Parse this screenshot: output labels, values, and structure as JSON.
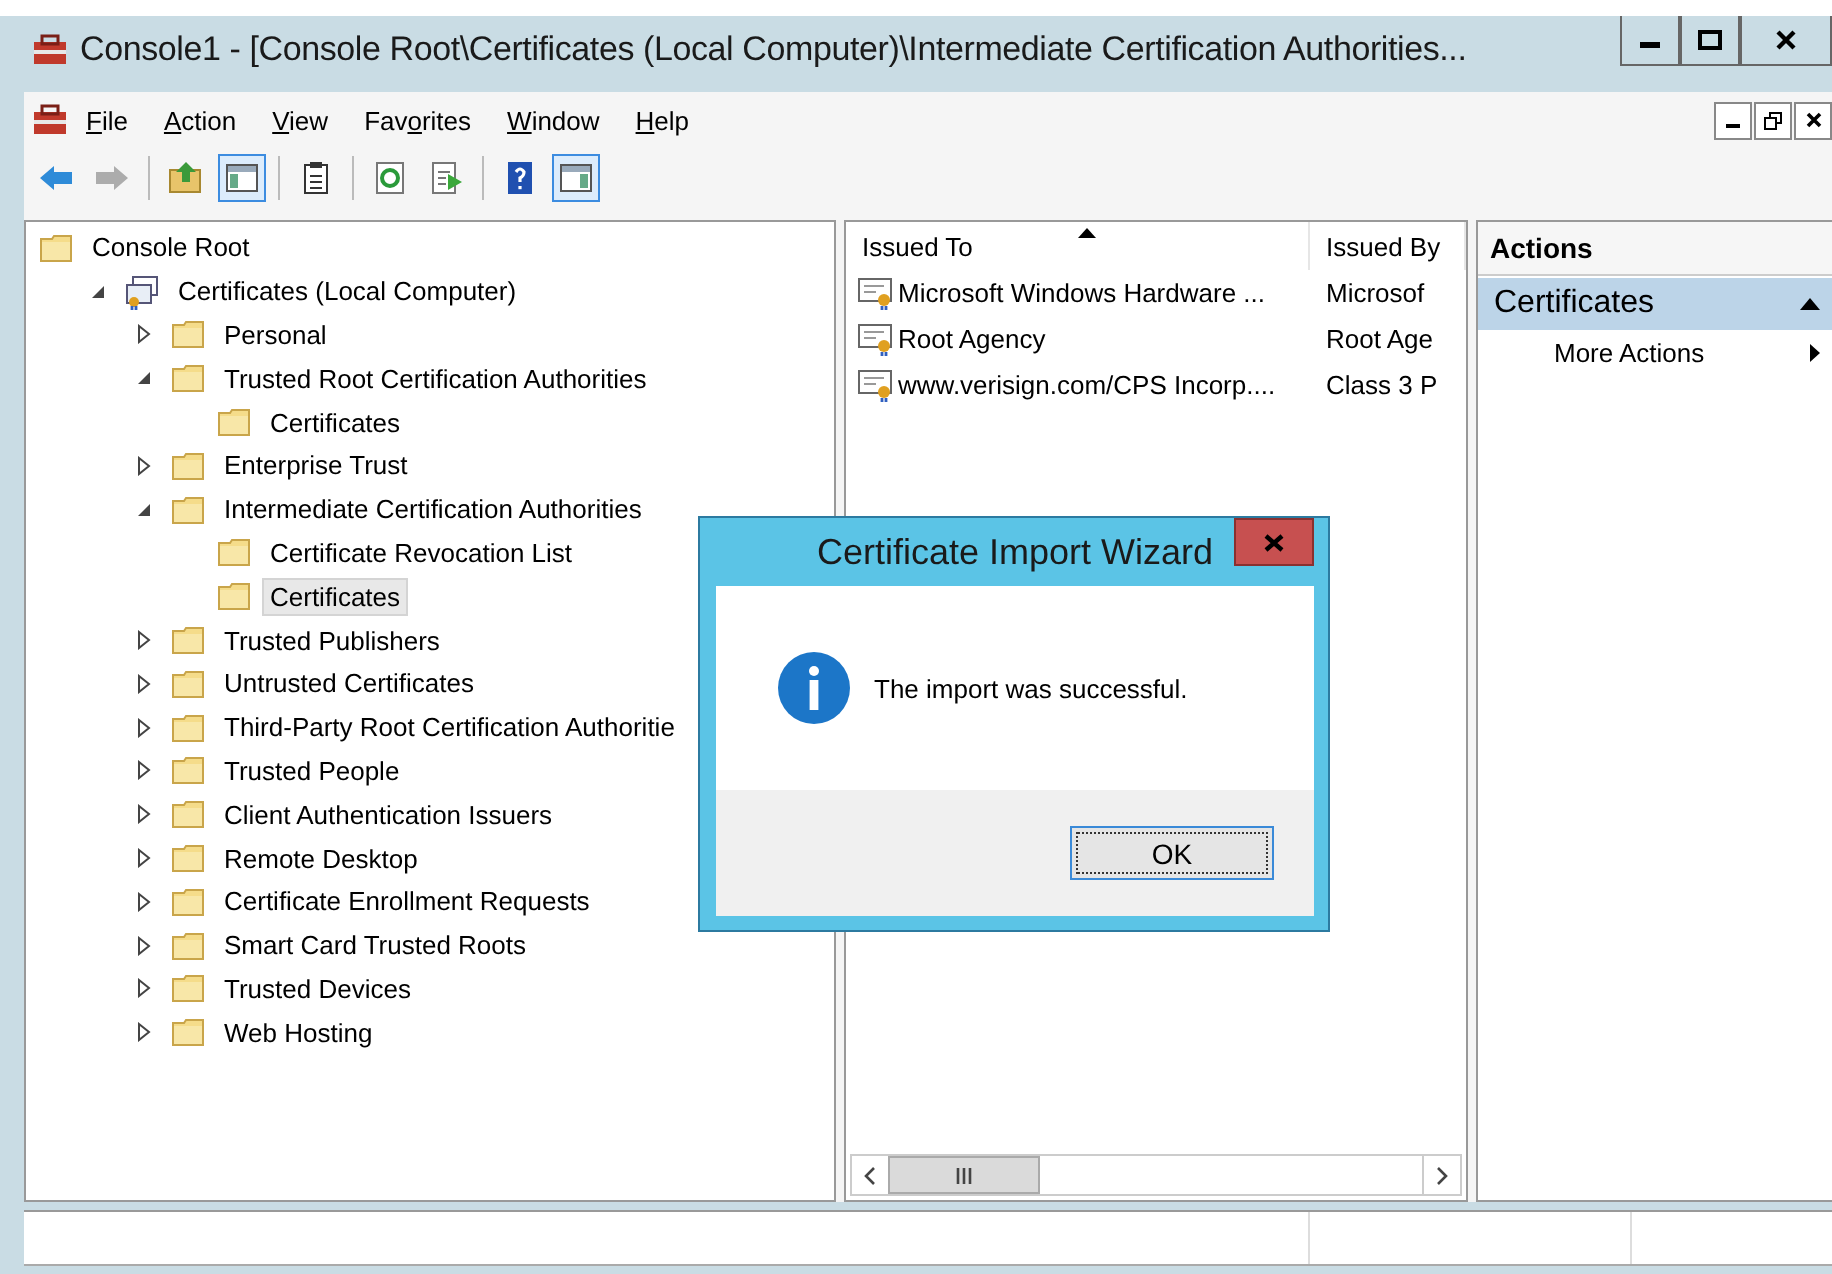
{
  "window": {
    "title": "Console1 - [Console Root\\Certificates (Local Computer)\\Intermediate Certification Authorities..."
  },
  "menu": [
    {
      "key": "F",
      "post": "ile"
    },
    {
      "key": "A",
      "post": "ction"
    },
    {
      "key": "V",
      "post": "iew"
    },
    {
      "pre": "Fav",
      "key": "o",
      "post": "rites"
    },
    {
      "key": "W",
      "post": "indow"
    },
    {
      "key": "H",
      "post": "elp"
    }
  ],
  "toolbar": [
    {
      "kind": "back",
      "pressed": false,
      "disabled": false
    },
    {
      "kind": "forward",
      "pressed": false,
      "disabled": true
    },
    {
      "kind": "sep"
    },
    {
      "kind": "up",
      "pressed": false,
      "disabled": false
    },
    {
      "kind": "tree",
      "pressed": true,
      "disabled": false
    },
    {
      "kind": "sep"
    },
    {
      "kind": "clipboard",
      "pressed": false,
      "disabled": false
    },
    {
      "kind": "sep"
    },
    {
      "kind": "refresh",
      "pressed": false,
      "disabled": false
    },
    {
      "kind": "export",
      "pressed": false,
      "disabled": false
    },
    {
      "kind": "sep"
    },
    {
      "kind": "help",
      "pressed": false,
      "disabled": false
    },
    {
      "kind": "actionpane",
      "pressed": true,
      "disabled": false
    }
  ],
  "tree": [
    {
      "label": "Console Root",
      "kind": "folder",
      "selected": false,
      "children": [
        {
          "label": "Certificates (Local Computer)",
          "kind": "store",
          "selected": false,
          "expanded": true,
          "children": [
            {
              "label": "Personal",
              "kind": "folder",
              "selected": false,
              "expanded": false
            },
            {
              "label": "Trusted Root Certification Authorities",
              "kind": "folder",
              "selected": false,
              "expanded": true,
              "children": [
                {
                  "label": "Certificates",
                  "kind": "folder",
                  "selected": false
                }
              ]
            },
            {
              "label": "Enterprise Trust",
              "kind": "folder",
              "selected": false,
              "expanded": false
            },
            {
              "label": "Intermediate Certification Authorities",
              "kind": "folder",
              "selected": false,
              "expanded": true,
              "children": [
                {
                  "label": "Certificate Revocation List",
                  "kind": "folder",
                  "selected": false
                },
                {
                  "label": "Certificates",
                  "kind": "folder",
                  "selected": true
                }
              ]
            },
            {
              "label": "Trusted Publishers",
              "kind": "folder",
              "selected": false,
              "expanded": false
            },
            {
              "label": "Untrusted Certificates",
              "kind": "folder",
              "selected": false,
              "expanded": false
            },
            {
              "label": "Third-Party Root Certification Authoritie",
              "kind": "folder",
              "selected": false,
              "expanded": false
            },
            {
              "label": "Trusted People",
              "kind": "folder",
              "selected": false,
              "expanded": false
            },
            {
              "label": "Client Authentication Issuers",
              "kind": "folder",
              "selected": false,
              "expanded": false
            },
            {
              "label": "Remote Desktop",
              "kind": "folder",
              "selected": false,
              "expanded": false
            },
            {
              "label": "Certificate Enrollment Requests",
              "kind": "folder",
              "selected": false,
              "expanded": false
            },
            {
              "label": "Smart Card Trusted Roots",
              "kind": "folder",
              "selected": false,
              "expanded": false
            },
            {
              "label": "Trusted Devices",
              "kind": "folder",
              "selected": false,
              "expanded": false
            },
            {
              "label": "Web Hosting",
              "kind": "folder",
              "selected": false,
              "expanded": false
            }
          ]
        }
      ]
    }
  ],
  "list": {
    "columns": [
      {
        "label": "Issued To",
        "sorted": true
      },
      {
        "label": "Issued By",
        "sorted": false
      }
    ],
    "rows": [
      [
        "Microsoft Windows Hardware ...",
        "Microsof"
      ],
      [
        "Root Agency",
        "Root Age"
      ],
      [
        "www.verisign.com/CPS Incorp....",
        "Class 3 P"
      ]
    ]
  },
  "actions": {
    "title": "Actions",
    "section": "Certificates",
    "expanded": true,
    "items": [
      "More Actions"
    ]
  },
  "dialog": {
    "title": "Certificate Import Wizard",
    "message": "The import was successful.",
    "button": "OK"
  }
}
